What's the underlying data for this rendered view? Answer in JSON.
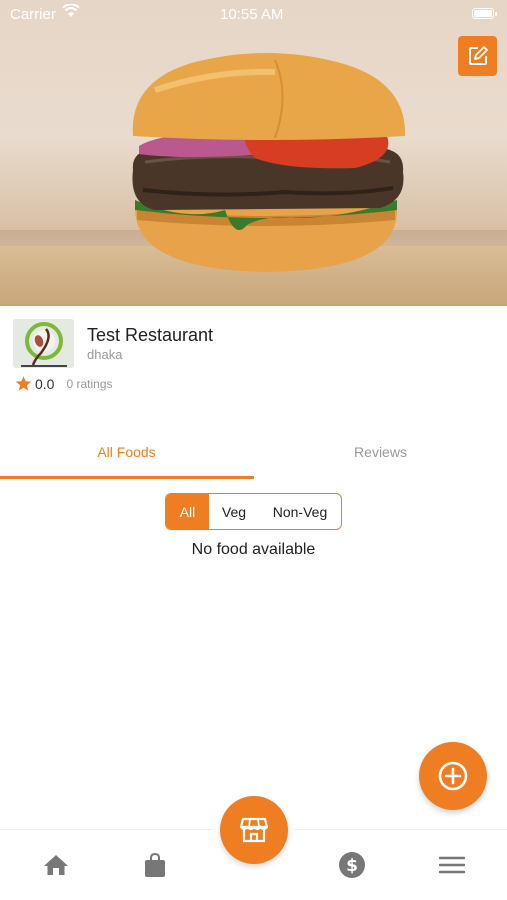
{
  "status_bar": {
    "carrier": "Carrier",
    "time": "10:55 AM"
  },
  "restaurant": {
    "name": "Test Restaurant",
    "location": "dhaka",
    "rating": "0.0",
    "ratings_count": "0 ratings"
  },
  "tabs": [
    {
      "label": "All Foods",
      "active": true
    },
    {
      "label": "Reviews",
      "active": false
    }
  ],
  "filter": {
    "options": [
      "All",
      "Veg",
      "Non-Veg"
    ],
    "selected": "All"
  },
  "empty_message": "No food available",
  "icons": {
    "edit": "edit-icon",
    "add": "add-circle-icon",
    "home": "home-icon",
    "bag": "shopping-bag-icon",
    "store": "store-icon",
    "money": "dollar-icon",
    "menu": "menu-icon"
  },
  "colors": {
    "accent": "#ef7d22",
    "muted": "#999999",
    "nav_icon": "#777777"
  }
}
